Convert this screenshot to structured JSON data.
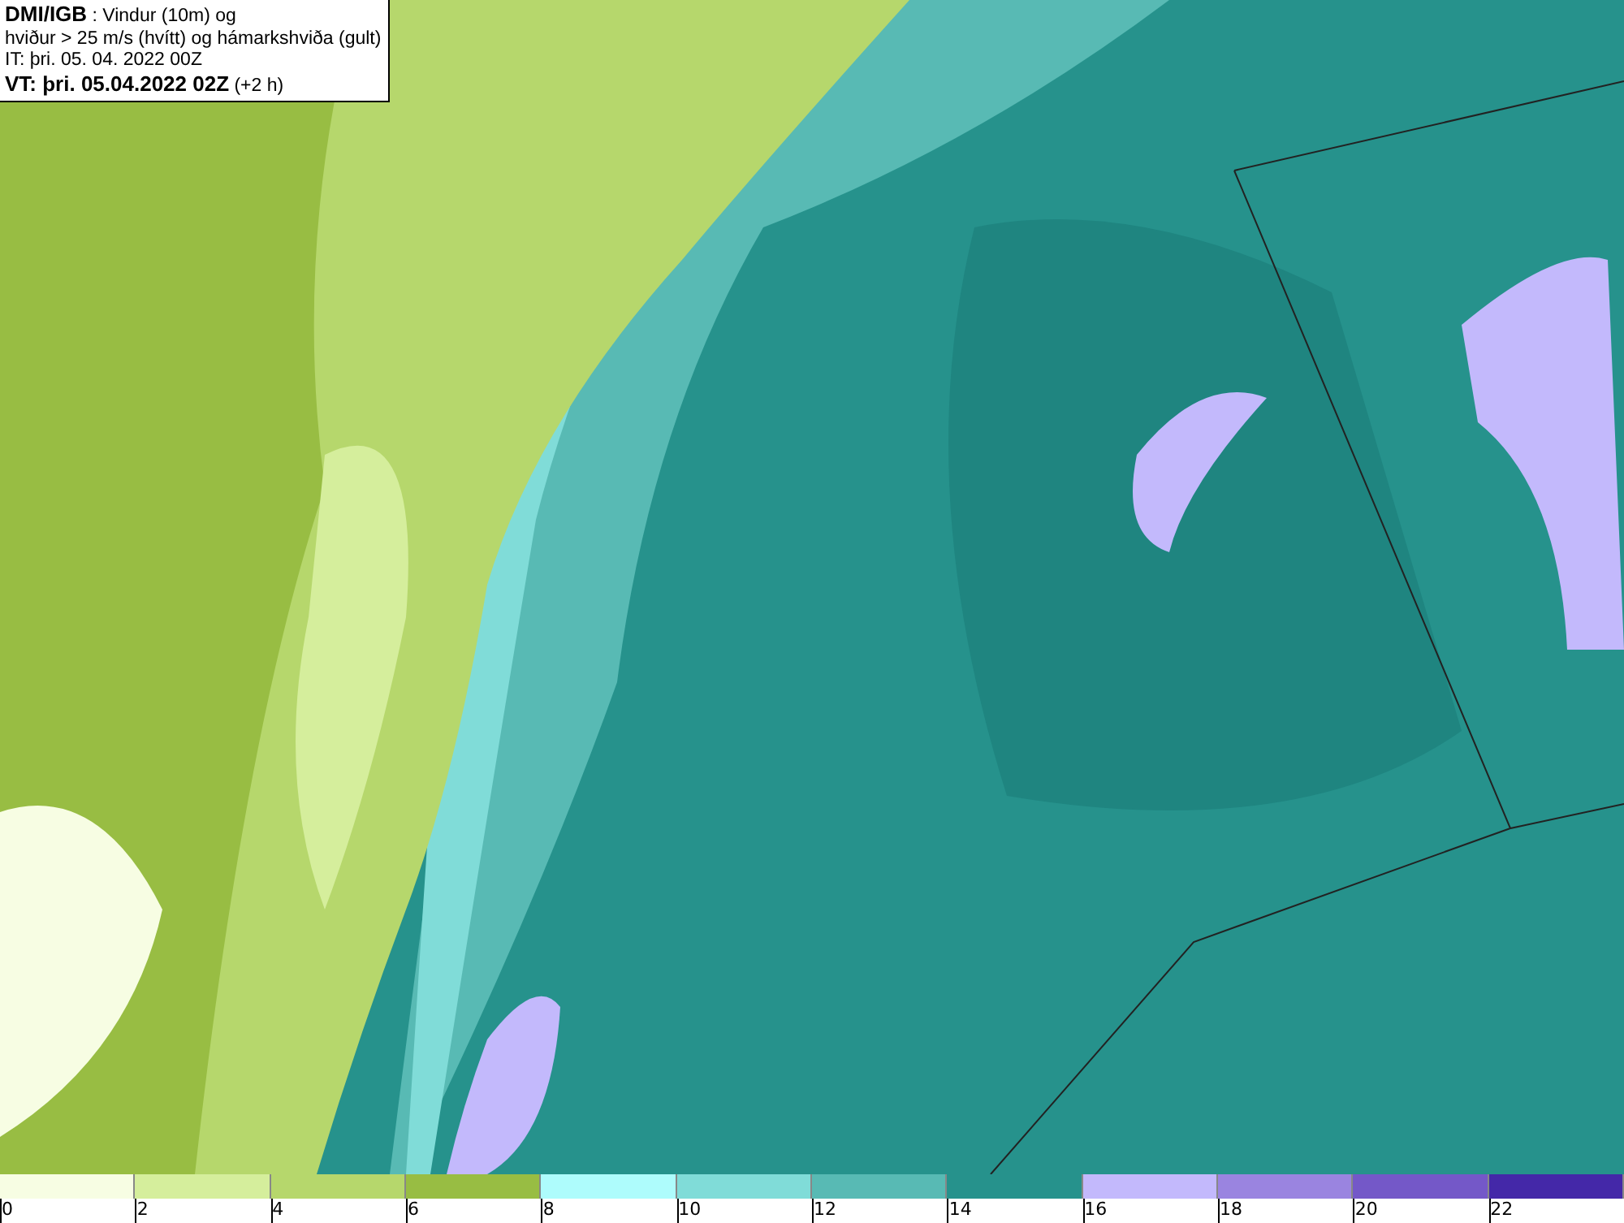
{
  "title_box": {
    "lines": [
      "**DMI/IGB** : Vindur (10m) og",
      "hviður > 25 m/s (hvítt) og hámarkshviða (gult)",
      "IT: þri. 05. 04. 2022 00Z",
      "**VT: þri. 05.04.2022 02Z** (+2 h)"
    ]
  },
  "legend": {
    "bins": [
      {
        "color": "#f7fde3"
      },
      {
        "color": "#d5ee9c"
      },
      {
        "color": "#b6d76c"
      },
      {
        "color": "#98bd43"
      },
      {
        "color": "#aefcfc"
      },
      {
        "color": "#80dcd8"
      },
      {
        "color": "#58bab4"
      },
      {
        "color": "#26928c"
      },
      {
        "color": "#c3b9fc"
      },
      {
        "color": "#9a84e0"
      },
      {
        "color": "#7458c8"
      },
      {
        "color": "#4428a8"
      }
    ],
    "ticks": [
      "0",
      "2",
      "4",
      "6",
      "8",
      "10",
      "12",
      "14",
      "16",
      "18",
      "20",
      "22"
    ]
  }
}
